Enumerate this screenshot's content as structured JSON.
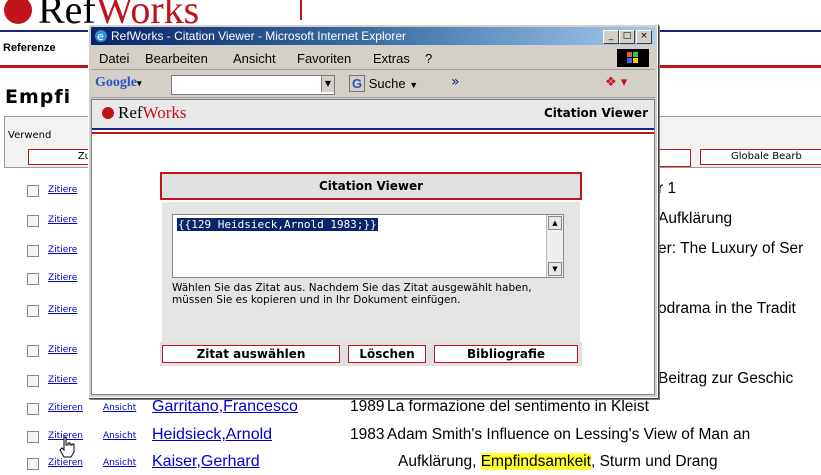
{
  "background": {
    "logo_ref": "Ref",
    "logo_works": "Works",
    "ref_label": "Referenze",
    "heading": "Empfi",
    "verwend_label": "Verwend",
    "zu_button": "Zu",
    "global_button": "Globale Bearb",
    "rows": [
      {
        "cite": "Zitiere",
        "view": "",
        "author": "",
        "year": "",
        "title": "r 1",
        "highlight": ""
      },
      {
        "cite": "Zitiere",
        "view": "",
        "author": "",
        "year": "",
        "title": "Aufklärung",
        "highlight": ""
      },
      {
        "cite": "Zitiere",
        "view": "",
        "author": "",
        "year": "",
        "title": "er: The Luxury of Ser",
        "highlight": ""
      },
      {
        "cite": "Zitiere",
        "view": "",
        "author": "",
        "year": "",
        "title": "",
        "highlight": ""
      },
      {
        "cite": "Zitiere",
        "view": "",
        "author": "",
        "year": "",
        "title": "odrama in the Tradit",
        "highlight": ""
      },
      {
        "cite": "Zitiere",
        "view": "",
        "author": "",
        "year": "",
        "title": "",
        "highlight": ""
      },
      {
        "cite": "Zitiere",
        "view": "",
        "author": "",
        "year": "",
        "title": "Beitrag zur Geschic",
        "highlight": ""
      },
      {
        "cite": "Zitieren",
        "view": "Ansicht",
        "author": "Garritano,Francesco",
        "year": "1989",
        "title": "La formazione del sentimento in Kleist",
        "highlight": ""
      },
      {
        "cite": "Zitieren",
        "view": "Ansicht",
        "author": "Heidsieck,Arnold",
        "year": "1983",
        "title": "Adam Smith's Influence on Lessing's View of Man an",
        "highlight": ""
      },
      {
        "cite": "Zitieren",
        "view": "Ansicht",
        "author": "Kaiser,Gerhard",
        "year": "",
        "title_pre": "Aufklärung, ",
        "highlight": "Empfindsamkeit",
        "title_post": ", Sturm und Drang"
      }
    ]
  },
  "window": {
    "title": "RefWorks - Citation Viewer - Microsoft Internet Explorer",
    "buttons": {
      "minimize": "_",
      "maximize": "□",
      "close": "×"
    },
    "menu": [
      "Datei",
      "Bearbeiten",
      "Ansicht",
      "Favoriten",
      "Extras",
      "?"
    ],
    "google_label": "Google",
    "google_search": "Suche",
    "google_more": "»"
  },
  "refworks": {
    "logo_ref": "Ref",
    "logo_works": "Works",
    "header_title": "Citation Viewer",
    "panel_title": "Citation Viewer",
    "citation_text": "{{129 Heidsieck,Arnold 1983;}}",
    "help_text": "Wählen Sie das Zitat aus.  Nachdem Sie das Zitat ausgewählt haben, müssen Sie es kopieren und in Ihr Dokument einfügen.",
    "btn_select": "Zitat auswählen",
    "btn_delete": "Löschen",
    "btn_bibliography": "Bibliografie"
  },
  "colors": {
    "accent_red": "#c0141b",
    "link_blue": "#0000cc",
    "navy": "#1a237e",
    "highlight": "#ffff33"
  }
}
